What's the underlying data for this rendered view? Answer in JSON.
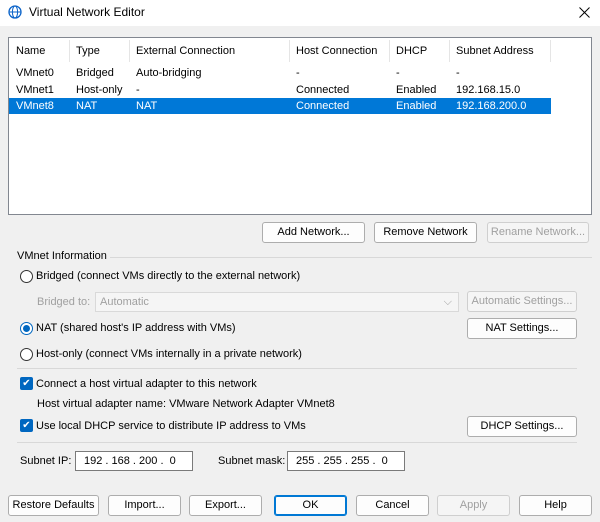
{
  "window": {
    "title": "Virtual Network Editor"
  },
  "list": {
    "columns": [
      "Name",
      "Type",
      "External Connection",
      "Host Connection",
      "DHCP",
      "Subnet Address"
    ],
    "rows": [
      [
        "VMnet0",
        "Bridged",
        "Auto-bridging",
        "-",
        "-",
        "-"
      ],
      [
        "VMnet1",
        "Host-only",
        "-",
        "Connected",
        "Enabled",
        "192.168.15.0"
      ],
      [
        "VMnet8",
        "NAT",
        "NAT",
        "Connected",
        "Enabled",
        "192.168.200.0"
      ]
    ],
    "selected_row": 2
  },
  "list_buttons": {
    "add": "Add Network...",
    "remove": "Remove Network",
    "rename": "Rename Network..."
  },
  "vmnet_info": {
    "group_label": "VMnet Information",
    "bridged_label": "Bridged (connect VMs directly to the external network)",
    "bridged_to_label": "Bridged to:",
    "bridged_to_value": "Automatic",
    "auto_settings": "Automatic Settings...",
    "nat_label": "NAT (shared host's IP address with VMs)",
    "nat_settings": "NAT Settings...",
    "hostonly_label": "Host-only (connect VMs internally in a private network)",
    "connect_adapter_label": "Connect a host virtual adapter to this network",
    "adapter_name_text": "Host virtual adapter name: VMware Network Adapter VMnet8",
    "dhcp_label": "Use local DHCP service to distribute IP address to VMs",
    "dhcp_settings": "DHCP Settings...",
    "subnet_ip_label": "Subnet IP:",
    "subnet_ip_value": "192 . 168 . 200 .  0",
    "subnet_mask_label": "Subnet mask:",
    "subnet_mask_value": "255 . 255 . 255 .  0",
    "selected_mode": "NAT",
    "connect_adapter_checked": true,
    "dhcp_checked": true
  },
  "footer": {
    "restore": "Restore Defaults",
    "import": "Import...",
    "export": "Export...",
    "ok": "OK",
    "cancel": "Cancel",
    "apply": "Apply",
    "help": "Help"
  },
  "colors": {
    "selection": "#0078d7",
    "accent": "#0067c0"
  }
}
